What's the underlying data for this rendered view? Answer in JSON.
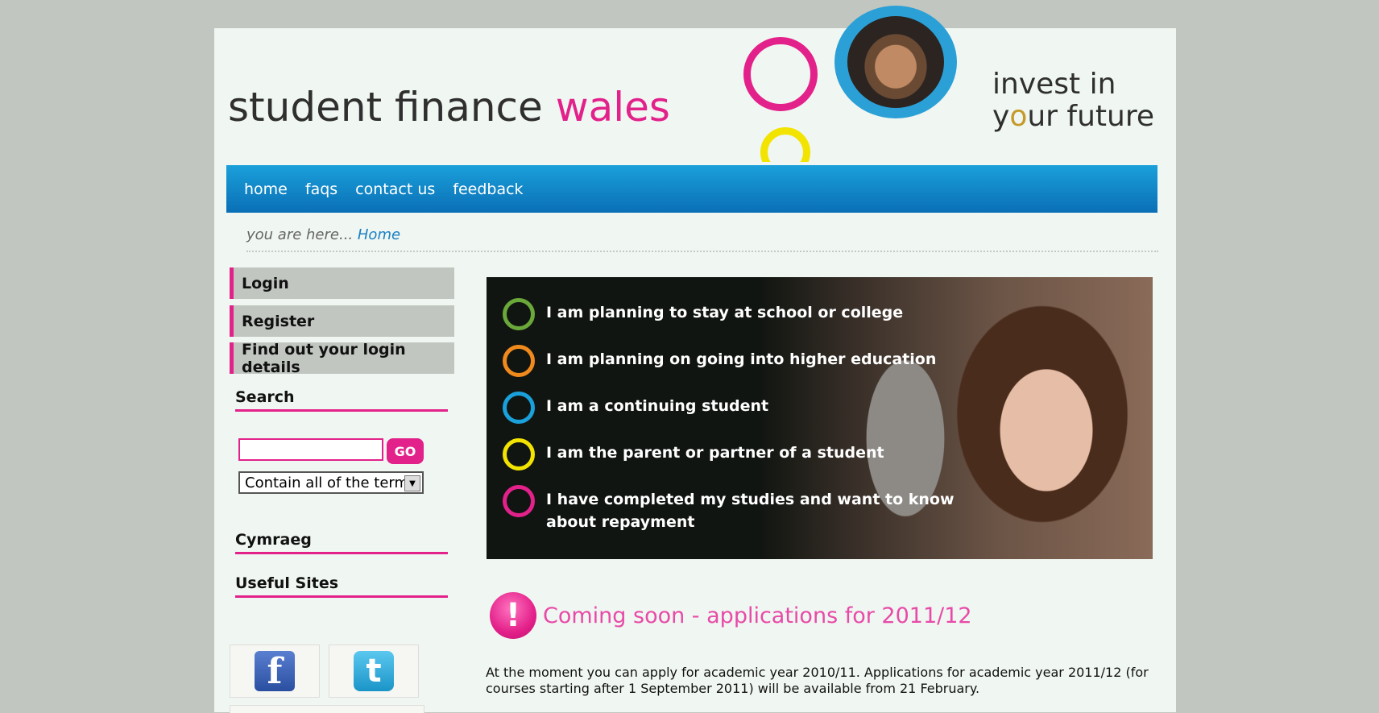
{
  "header": {
    "logo_main": "student finance",
    "logo_accent": "wales",
    "tagline_line1": "invest in",
    "tagline_line2_o": "o",
    "tagline_line2_y": "y",
    "tagline_line2_rest": "ur future"
  },
  "nav": {
    "items": [
      "home",
      "faqs",
      "contact us",
      "feedback"
    ]
  },
  "breadcrumb": {
    "prefix": "you are here...",
    "current": "Home"
  },
  "sidebar": {
    "login": "Login",
    "register": "Register",
    "find_login": "Find out your login details",
    "search_heading": "Search",
    "search_value": "",
    "go_label": "GO",
    "search_option": "Contain all of the terms",
    "cymraeg": "Cymraeg",
    "useful_sites": "Useful Sites",
    "social": [
      "facebook-icon",
      "twitter-icon"
    ]
  },
  "banner": {
    "items": [
      {
        "label": "I am planning to stay at school or college",
        "color": "#6aa83a"
      },
      {
        "label": "I am planning on going into higher education",
        "color": "#f08a1c"
      },
      {
        "label": "I am a continuing student",
        "color": "#1aa0da"
      },
      {
        "label": "I am the parent or partner of a student",
        "color": "#f2e400"
      },
      {
        "label": "I have completed my studies and want to know about repayment",
        "color": "#e3218a"
      }
    ]
  },
  "notice": {
    "icon": "!",
    "title": "Coming soon - applications for 2011/12",
    "body": "At the moment you can apply for academic year 2010/11. Applications for academic year 2011/12 (for courses starting after 1 September 2011) will be available from 21 February."
  },
  "colors": {
    "brand_pink": "#e3218a",
    "nav_blue": "#0a6fb6",
    "background": "#c1c6c0"
  }
}
